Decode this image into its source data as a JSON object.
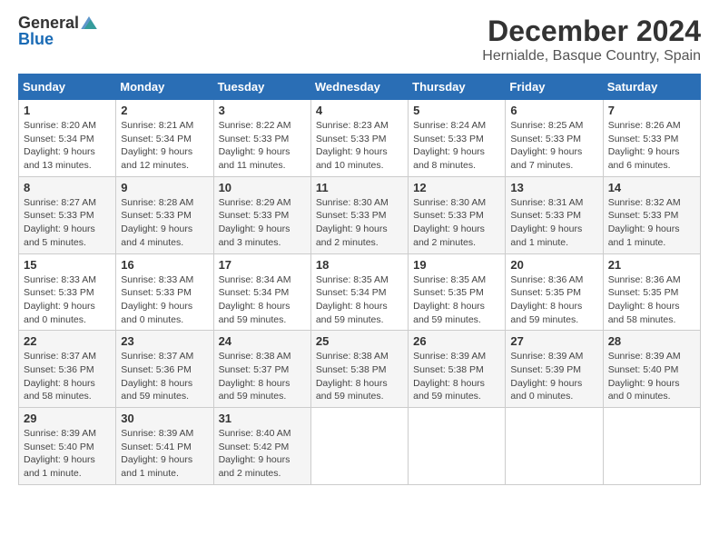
{
  "logo": {
    "general": "General",
    "blue": "Blue"
  },
  "title": "December 2024",
  "location": "Hernialde, Basque Country, Spain",
  "days_header": [
    "Sunday",
    "Monday",
    "Tuesday",
    "Wednesday",
    "Thursday",
    "Friday",
    "Saturday"
  ],
  "weeks": [
    [
      {
        "day": "1",
        "sunrise": "Sunrise: 8:20 AM",
        "sunset": "Sunset: 5:34 PM",
        "daylight": "Daylight: 9 hours and 13 minutes."
      },
      {
        "day": "2",
        "sunrise": "Sunrise: 8:21 AM",
        "sunset": "Sunset: 5:34 PM",
        "daylight": "Daylight: 9 hours and 12 minutes."
      },
      {
        "day": "3",
        "sunrise": "Sunrise: 8:22 AM",
        "sunset": "Sunset: 5:33 PM",
        "daylight": "Daylight: 9 hours and 11 minutes."
      },
      {
        "day": "4",
        "sunrise": "Sunrise: 8:23 AM",
        "sunset": "Sunset: 5:33 PM",
        "daylight": "Daylight: 9 hours and 10 minutes."
      },
      {
        "day": "5",
        "sunrise": "Sunrise: 8:24 AM",
        "sunset": "Sunset: 5:33 PM",
        "daylight": "Daylight: 9 hours and 8 minutes."
      },
      {
        "day": "6",
        "sunrise": "Sunrise: 8:25 AM",
        "sunset": "Sunset: 5:33 PM",
        "daylight": "Daylight: 9 hours and 7 minutes."
      },
      {
        "day": "7",
        "sunrise": "Sunrise: 8:26 AM",
        "sunset": "Sunset: 5:33 PM",
        "daylight": "Daylight: 9 hours and 6 minutes."
      }
    ],
    [
      {
        "day": "8",
        "sunrise": "Sunrise: 8:27 AM",
        "sunset": "Sunset: 5:33 PM",
        "daylight": "Daylight: 9 hours and 5 minutes."
      },
      {
        "day": "9",
        "sunrise": "Sunrise: 8:28 AM",
        "sunset": "Sunset: 5:33 PM",
        "daylight": "Daylight: 9 hours and 4 minutes."
      },
      {
        "day": "10",
        "sunrise": "Sunrise: 8:29 AM",
        "sunset": "Sunset: 5:33 PM",
        "daylight": "Daylight: 9 hours and 3 minutes."
      },
      {
        "day": "11",
        "sunrise": "Sunrise: 8:30 AM",
        "sunset": "Sunset: 5:33 PM",
        "daylight": "Daylight: 9 hours and 2 minutes."
      },
      {
        "day": "12",
        "sunrise": "Sunrise: 8:30 AM",
        "sunset": "Sunset: 5:33 PM",
        "daylight": "Daylight: 9 hours and 2 minutes."
      },
      {
        "day": "13",
        "sunrise": "Sunrise: 8:31 AM",
        "sunset": "Sunset: 5:33 PM",
        "daylight": "Daylight: 9 hours and 1 minute."
      },
      {
        "day": "14",
        "sunrise": "Sunrise: 8:32 AM",
        "sunset": "Sunset: 5:33 PM",
        "daylight": "Daylight: 9 hours and 1 minute."
      }
    ],
    [
      {
        "day": "15",
        "sunrise": "Sunrise: 8:33 AM",
        "sunset": "Sunset: 5:33 PM",
        "daylight": "Daylight: 9 hours and 0 minutes."
      },
      {
        "day": "16",
        "sunrise": "Sunrise: 8:33 AM",
        "sunset": "Sunset: 5:33 PM",
        "daylight": "Daylight: 9 hours and 0 minutes."
      },
      {
        "day": "17",
        "sunrise": "Sunrise: 8:34 AM",
        "sunset": "Sunset: 5:34 PM",
        "daylight": "Daylight: 8 hours and 59 minutes."
      },
      {
        "day": "18",
        "sunrise": "Sunrise: 8:35 AM",
        "sunset": "Sunset: 5:34 PM",
        "daylight": "Daylight: 8 hours and 59 minutes."
      },
      {
        "day": "19",
        "sunrise": "Sunrise: 8:35 AM",
        "sunset": "Sunset: 5:35 PM",
        "daylight": "Daylight: 8 hours and 59 minutes."
      },
      {
        "day": "20",
        "sunrise": "Sunrise: 8:36 AM",
        "sunset": "Sunset: 5:35 PM",
        "daylight": "Daylight: 8 hours and 59 minutes."
      },
      {
        "day": "21",
        "sunrise": "Sunrise: 8:36 AM",
        "sunset": "Sunset: 5:35 PM",
        "daylight": "Daylight: 8 hours and 58 minutes."
      }
    ],
    [
      {
        "day": "22",
        "sunrise": "Sunrise: 8:37 AM",
        "sunset": "Sunset: 5:36 PM",
        "daylight": "Daylight: 8 hours and 58 minutes."
      },
      {
        "day": "23",
        "sunrise": "Sunrise: 8:37 AM",
        "sunset": "Sunset: 5:36 PM",
        "daylight": "Daylight: 8 hours and 59 minutes."
      },
      {
        "day": "24",
        "sunrise": "Sunrise: 8:38 AM",
        "sunset": "Sunset: 5:37 PM",
        "daylight": "Daylight: 8 hours and 59 minutes."
      },
      {
        "day": "25",
        "sunrise": "Sunrise: 8:38 AM",
        "sunset": "Sunset: 5:38 PM",
        "daylight": "Daylight: 8 hours and 59 minutes."
      },
      {
        "day": "26",
        "sunrise": "Sunrise: 8:39 AM",
        "sunset": "Sunset: 5:38 PM",
        "daylight": "Daylight: 8 hours and 59 minutes."
      },
      {
        "day": "27",
        "sunrise": "Sunrise: 8:39 AM",
        "sunset": "Sunset: 5:39 PM",
        "daylight": "Daylight: 9 hours and 0 minutes."
      },
      {
        "day": "28",
        "sunrise": "Sunrise: 8:39 AM",
        "sunset": "Sunset: 5:40 PM",
        "daylight": "Daylight: 9 hours and 0 minutes."
      }
    ],
    [
      {
        "day": "29",
        "sunrise": "Sunrise: 8:39 AM",
        "sunset": "Sunset: 5:40 PM",
        "daylight": "Daylight: 9 hours and 1 minute."
      },
      {
        "day": "30",
        "sunrise": "Sunrise: 8:39 AM",
        "sunset": "Sunset: 5:41 PM",
        "daylight": "Daylight: 9 hours and 1 minute."
      },
      {
        "day": "31",
        "sunrise": "Sunrise: 8:40 AM",
        "sunset": "Sunset: 5:42 PM",
        "daylight": "Daylight: 9 hours and 2 minutes."
      },
      null,
      null,
      null,
      null
    ]
  ]
}
